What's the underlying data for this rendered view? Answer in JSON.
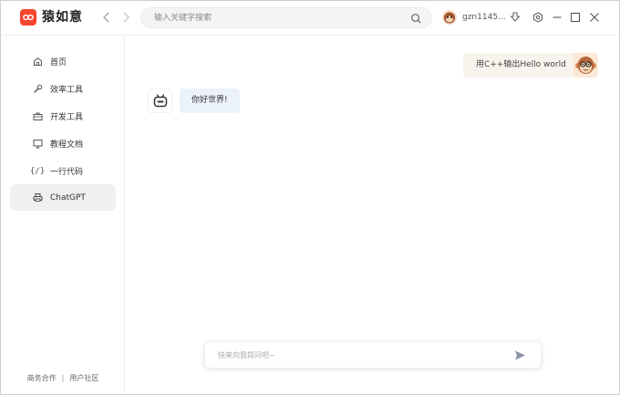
{
  "app": {
    "title": "猿如意",
    "brand_color": "#f5472f"
  },
  "header": {
    "back_icon": "chevron-left-icon",
    "forward_icon": "chevron-right-icon",
    "search": {
      "placeholder": "输入关键字搜索",
      "value": "",
      "icon": "search-icon"
    },
    "user": {
      "name": "gzn1145...",
      "avatar": "monkey-avatar"
    },
    "icons": [
      "download-icon",
      "settings-icon",
      "minimize-icon",
      "maximize-icon",
      "close-icon"
    ]
  },
  "sidebar": {
    "items": [
      {
        "label": "首页",
        "icon": "home-icon",
        "active": false
      },
      {
        "label": "效率工具",
        "icon": "wrench-icon",
        "active": false
      },
      {
        "label": "开发工具",
        "icon": "toolbox-icon",
        "active": false
      },
      {
        "label": "教程文档",
        "icon": "monitor-icon",
        "active": false
      },
      {
        "label": "一行代码",
        "icon": "code-icon",
        "glyph": "{/}",
        "active": false
      },
      {
        "label": "ChatGPT",
        "icon": "printer-icon",
        "active": true
      }
    ],
    "footer": {
      "link1": "商务合作",
      "separator": "|",
      "link2": "用户社区"
    }
  },
  "chat": {
    "messages": [
      {
        "role": "user",
        "text": "用C++输出Hello world"
      },
      {
        "role": "bot",
        "text": "你好世界!"
      }
    ],
    "input": {
      "placeholder": "快来向我提问吧~",
      "value": ""
    },
    "send_icon": "send-icon",
    "bubble_colors": {
      "user": "#f8f3ec",
      "bot": "#ecf2fb"
    }
  }
}
